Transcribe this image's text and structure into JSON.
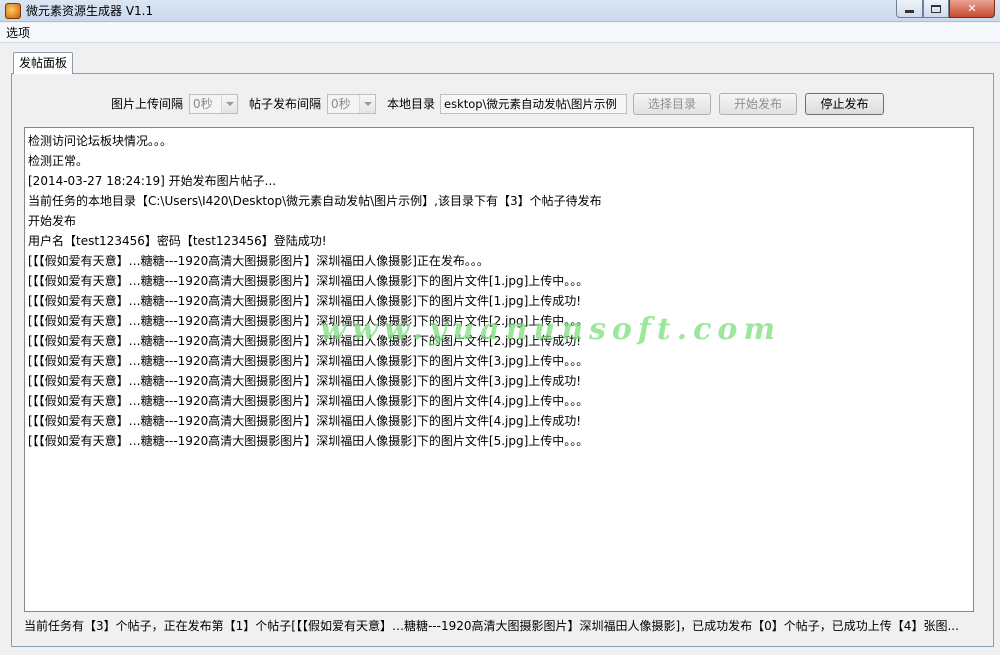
{
  "window": {
    "title": "微元素资源生成器 V1.1",
    "close_glyph": "✕"
  },
  "menu": {
    "options_label": "选项"
  },
  "tabs": [
    {
      "label": "发帖面板"
    }
  ],
  "toolbar": {
    "image_interval_label": "图片上传间隔",
    "image_interval_value": "0秒",
    "post_interval_label": "帖子发布间隔",
    "post_interval_value": "0秒",
    "local_dir_label": "本地目录",
    "local_dir_value": "esktop\\微元素自动发帖\\图片示例",
    "choose_dir_label": "选择目录",
    "start_label": "开始发布",
    "stop_label": "停止发布"
  },
  "log_lines": [
    "检测访问论坛板块情况。。。",
    "检测正常。",
    "[2014-03-27 18:24:19] 开始发布图片帖子...",
    "当前任务的本地目录【C:\\Users\\I420\\Desktop\\微元素自动发帖\\图片示例】,该目录下有【3】个帖子待发布",
    "开始发布",
    "用户名【test123456】密码【test123456】登陆成功!",
    "[【【假如爱有天意】…糖糖---1920高清大图摄影图片】深圳福田人像摄影]正在发布。。。",
    "[【【假如爱有天意】…糖糖---1920高清大图摄影图片】深圳福田人像摄影]下的图片文件[1.jpg]上传中。。。",
    "[【【假如爱有天意】…糖糖---1920高清大图摄影图片】深圳福田人像摄影]下的图片文件[1.jpg]上传成功!",
    "[【【假如爱有天意】…糖糖---1920高清大图摄影图片】深圳福田人像摄影]下的图片文件[2.jpg]上传中。。。",
    "[【【假如爱有天意】…糖糖---1920高清大图摄影图片】深圳福田人像摄影]下的图片文件[2.jpg]上传成功!",
    "[【【假如爱有天意】…糖糖---1920高清大图摄影图片】深圳福田人像摄影]下的图片文件[3.jpg]上传中。。。",
    "[【【假如爱有天意】…糖糖---1920高清大图摄影图片】深圳福田人像摄影]下的图片文件[3.jpg]上传成功!",
    "[【【假如爱有天意】…糖糖---1920高清大图摄影图片】深圳福田人像摄影]下的图片文件[4.jpg]上传中。。。",
    "[【【假如爱有天意】…糖糖---1920高清大图摄影图片】深圳福田人像摄影]下的图片文件[4.jpg]上传成功!",
    "[【【假如爱有天意】…糖糖---1920高清大图摄影图片】深圳福田人像摄影]下的图片文件[5.jpg]上传中。。。"
  ],
  "watermark": "www.yuanunsoft.com",
  "status_text": "当前任务有【3】个帖子，正在发布第【1】个帖子[【【假如爱有天意】…糖糖---1920高清大图摄影图片】深圳福田人像摄影]，已成功发布【0】个帖子，已成功上传【4】张图...",
  "icons": {
    "app": "app-icon",
    "minimize": "minimize-icon",
    "maximize": "maximize-icon",
    "close": "close-icon",
    "dropdown": "chevron-down-icon"
  }
}
